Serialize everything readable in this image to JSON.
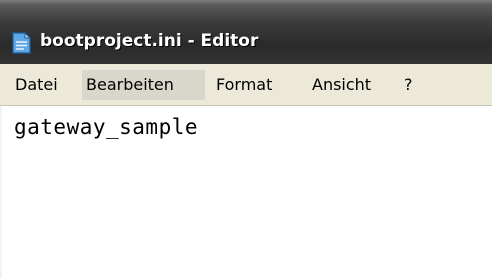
{
  "window": {
    "title": "bootproject.ini - Editor",
    "title_icon": "notepad-icon"
  },
  "menu": {
    "items": [
      {
        "label": "Datei"
      },
      {
        "label": "Bearbeiten",
        "highlighted": true
      },
      {
        "label": "Format"
      },
      {
        "label": "Ansicht"
      },
      {
        "label": "?"
      }
    ]
  },
  "editor": {
    "content": "gateway_sample"
  },
  "colors": {
    "titlebar": "#333333",
    "menubar": "#ece9d8",
    "menu_highlight": "#d9d7cb",
    "editor_background": "#ffffff"
  }
}
